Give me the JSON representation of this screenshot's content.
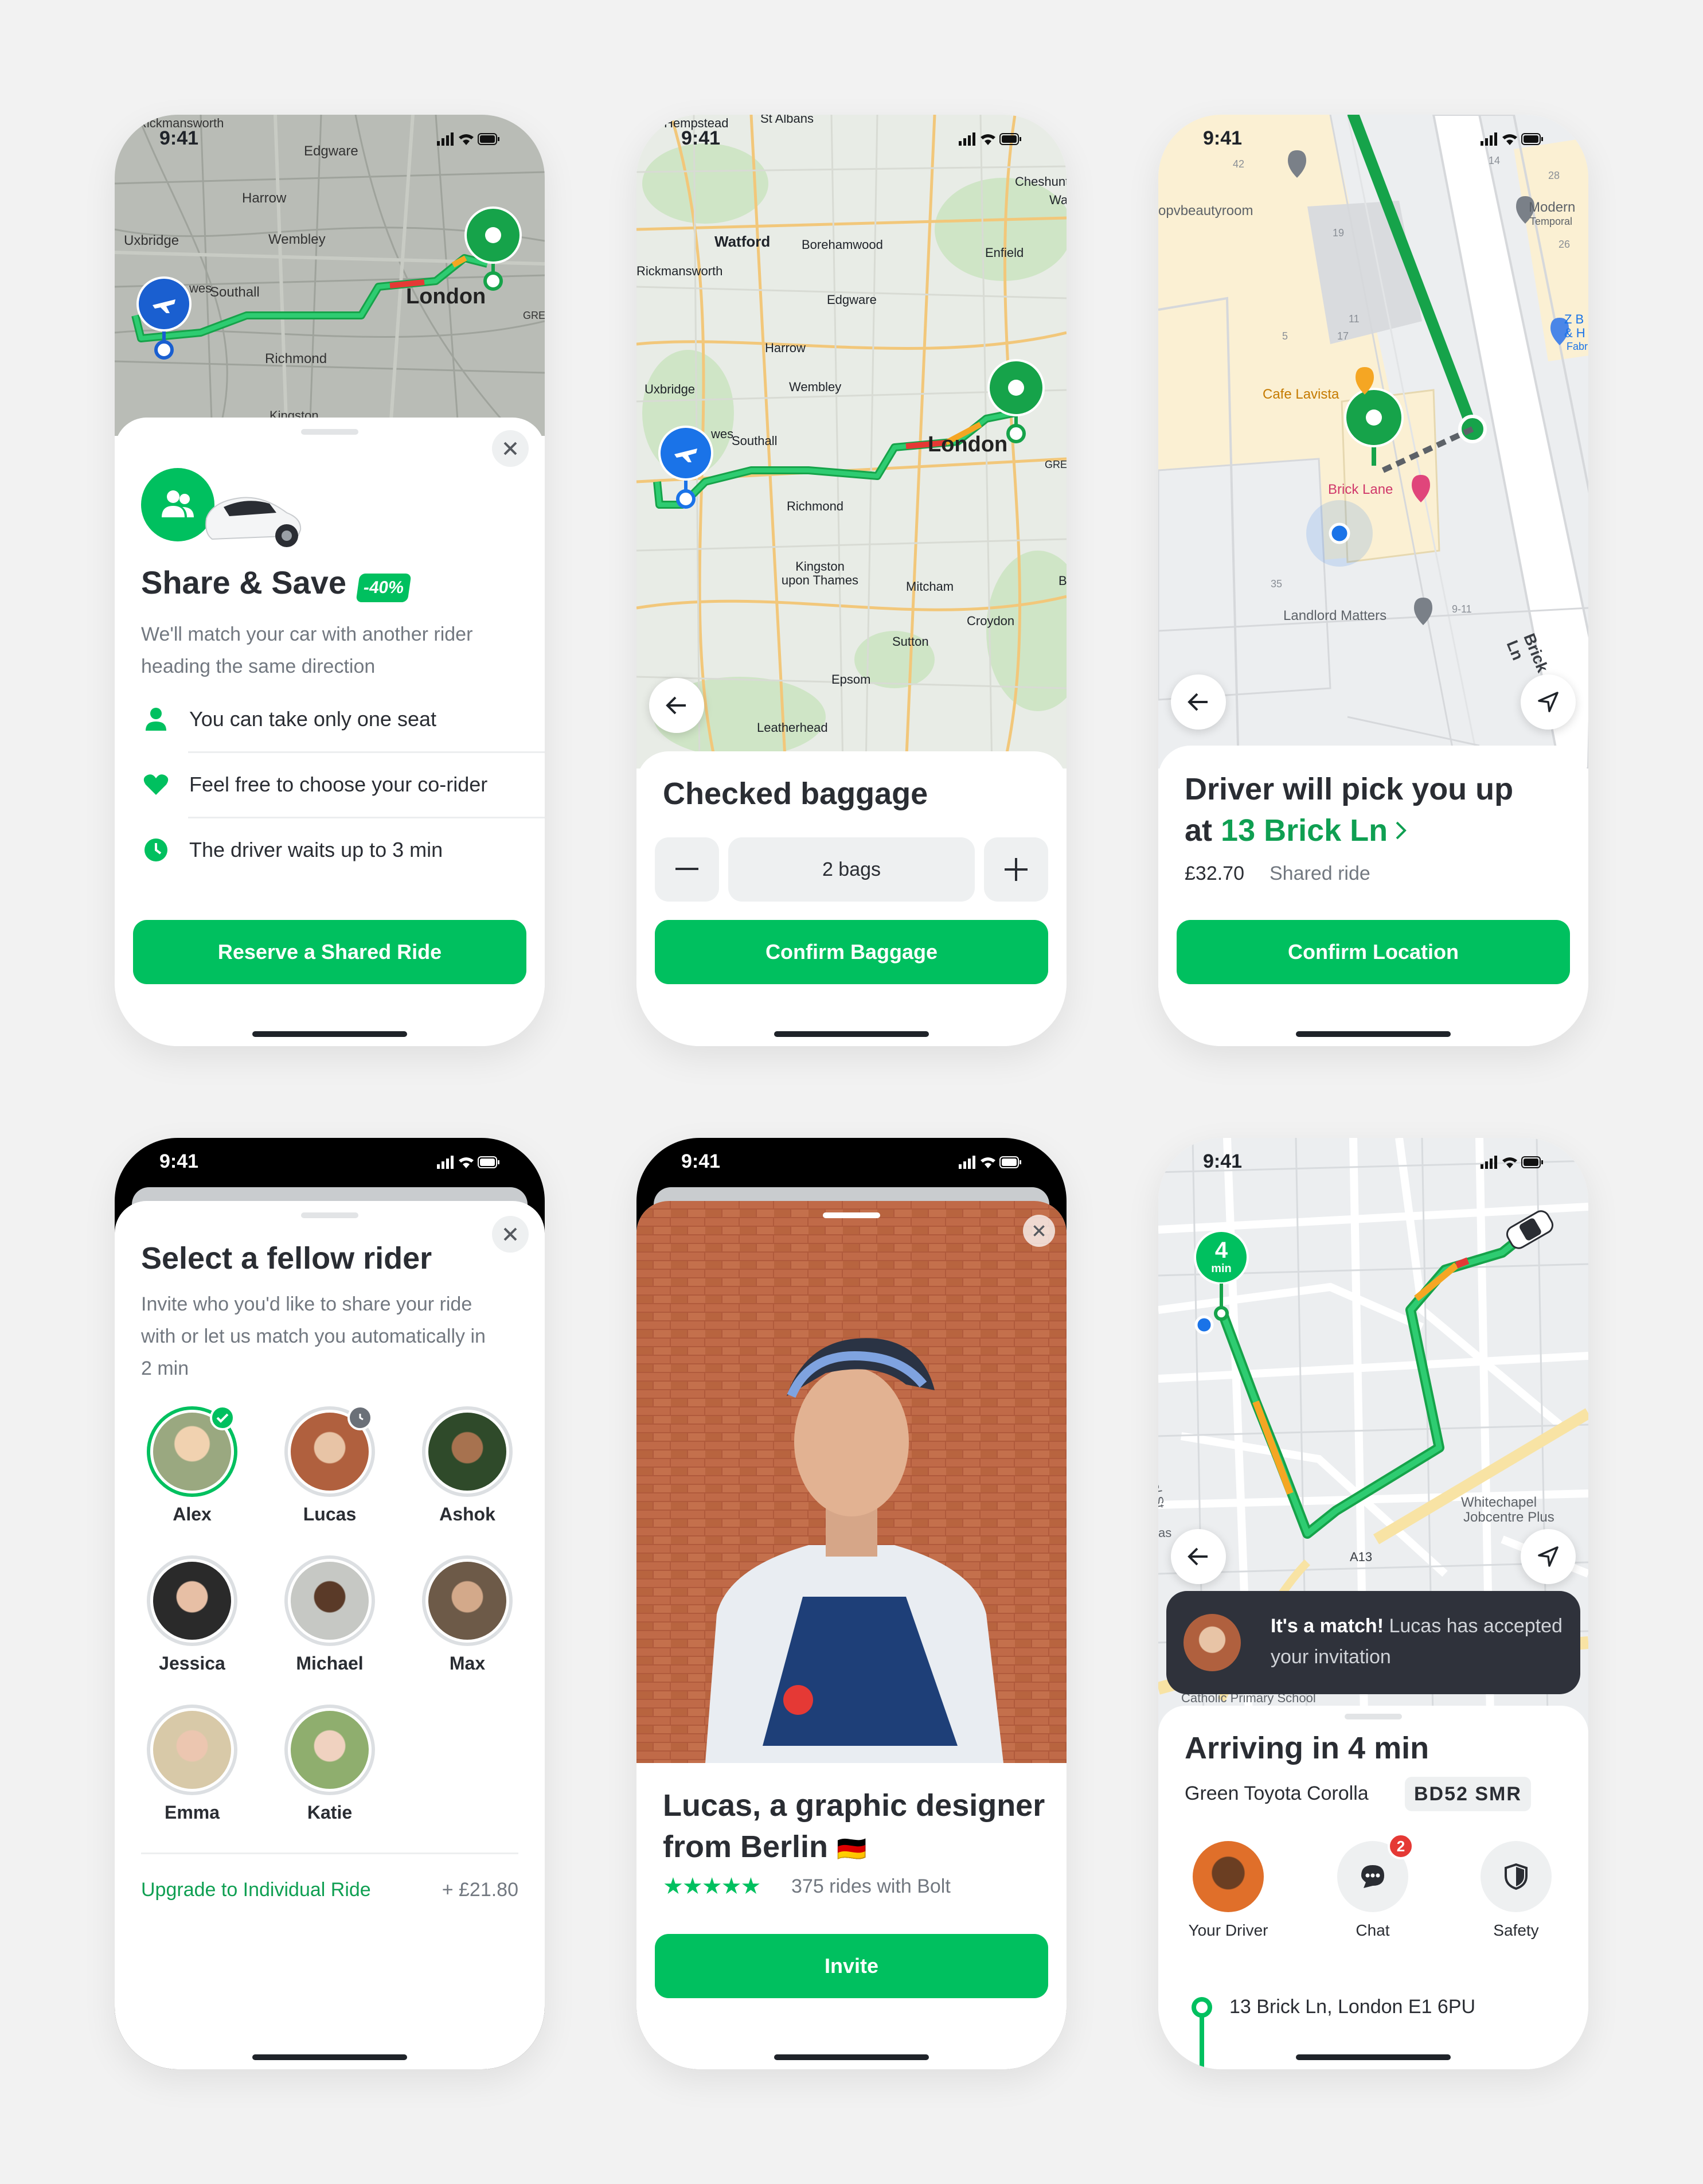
{
  "status_time": "9:41",
  "screen1": {
    "map_labels": [
      "Rickmansworth",
      "Edgware",
      "Harrow",
      "Uxbridge",
      "Wembley",
      "Southall",
      "London",
      "Richmond",
      "Kingston",
      "GRE",
      "wes"
    ],
    "title": "Share & Save",
    "badge": "-40%",
    "description": "We'll match your car with another rider heading the same direction",
    "features": [
      "You can take only one seat",
      "Feel free to choose your co-rider",
      "The driver waits up to 3 min"
    ],
    "button": "Reserve a Shared Ride"
  },
  "screen2": {
    "map_labels": [
      "Hempstead",
      "St Albans",
      "Cheshunt",
      "Waltham",
      "Watford",
      "Borehamwood",
      "Enfield",
      "Rickmansworth",
      "Edgware",
      "Harrow",
      "Uxbridge",
      "Wembley",
      "Southall",
      "London",
      "Richmond",
      "Kingston upon Thames",
      "Mitcham",
      "Croydon",
      "Sutton",
      "Epsom",
      "Leatherhead",
      "GRE",
      "B",
      "wes"
    ],
    "title": "Checked baggage",
    "stepper_value": "2 bags",
    "button": "Confirm Baggage"
  },
  "screen3": {
    "map_labels": [
      "opvbeautyroom",
      "Cafe Lavista",
      "Brick Lane",
      "Landlord Matters",
      "Modern",
      "Temporal",
      "Z B",
      "& H",
      "Fabr",
      "Brick Ln",
      "42",
      "19",
      "5",
      "11",
      "17",
      "35",
      "9-11",
      "14",
      "28",
      "26"
    ],
    "title_line1": "Driver will pick you up",
    "title_prefix": "at ",
    "title_address": "13 Brick Ln",
    "price": "£32.70",
    "ride_type": "Shared ride",
    "button": "Confirm Location"
  },
  "screen4": {
    "title": "Select a fellow rider",
    "description": "Invite who you'd like to share your ride with or let us match you automatically in 2 min",
    "riders": [
      "Alex",
      "Lucas",
      "Ashok",
      "Jessica",
      "Michael",
      "Max",
      "Emma",
      "Katie"
    ],
    "upgrade_label": "Upgrade to Individual Ride",
    "upgrade_price": "+ £21.80"
  },
  "screen5": {
    "title": "Lucas, a graphic designer from Berlin",
    "flag": "🇩🇪",
    "stars": "★★★★★",
    "rides": "375 rides with Bolt",
    "button": "Invite"
  },
  "screen6": {
    "eta_number": "4",
    "eta_unit": "min",
    "map_labels": [
      "Whitechapel",
      "Jobcentre Plus",
      "A13",
      "Catholic Primary School",
      "al St",
      "as"
    ],
    "toast_bold": "It's a match!",
    "toast_rest": " Lucas has accepted your invitation",
    "title": "Arriving in 4 min",
    "car": "Green Toyota Corolla",
    "plate": "BD52 SMR",
    "actions": [
      "Your Driver",
      "Chat",
      "Safety"
    ],
    "chat_badge": "2",
    "destination": "13 Brick Ln, London E1 6PU"
  },
  "colors": {
    "green": "#00c05f",
    "green_text": "#0f9f52",
    "blue": "#1a73e8",
    "dark": "#2a2d33"
  }
}
